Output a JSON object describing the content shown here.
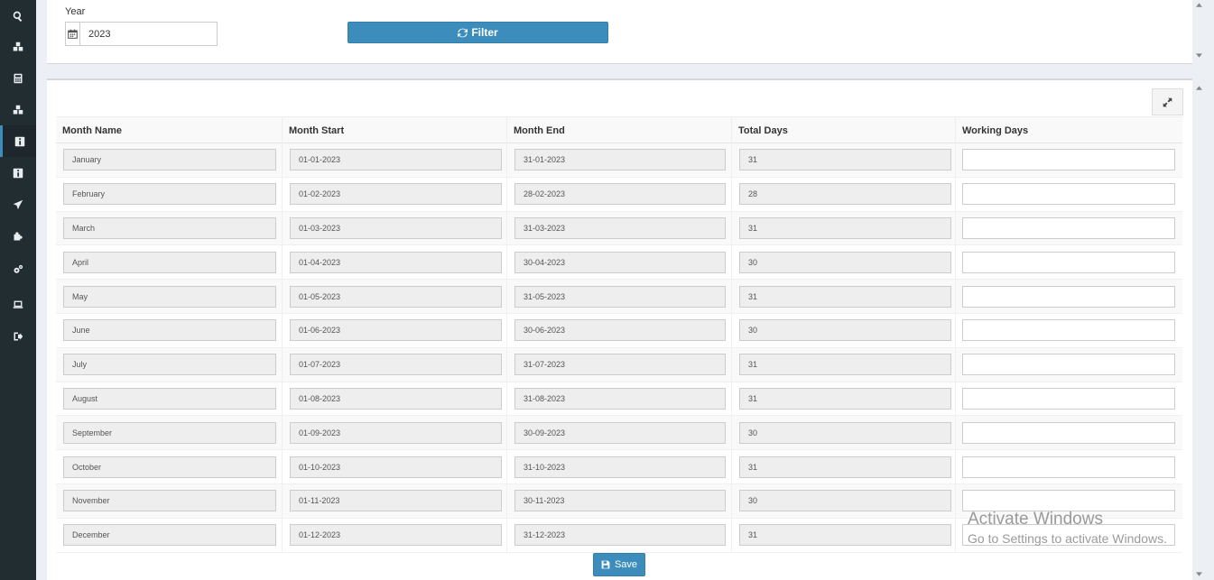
{
  "sidebar": {
    "icons": [
      "search-icon",
      "cubes-icon",
      "calculator-icon",
      "cubes-icon",
      "info-icon",
      "info-icon",
      "plane-icon",
      "puzzle-icon",
      "gears-icon",
      "laptop-icon",
      "sign-out-icon"
    ],
    "active_index": 4
  },
  "filter": {
    "year_label": "Year",
    "year_value": "2023",
    "filter_button": "Filter"
  },
  "table": {
    "headers": [
      "Month Name",
      "Month Start",
      "Month End",
      "Total Days",
      "Working Days"
    ],
    "rows": [
      {
        "month": "January",
        "start": "01-01-2023",
        "end": "31-01-2023",
        "total": "31",
        "working": ""
      },
      {
        "month": "February",
        "start": "01-02-2023",
        "end": "28-02-2023",
        "total": "28",
        "working": ""
      },
      {
        "month": "March",
        "start": "01-03-2023",
        "end": "31-03-2023",
        "total": "31",
        "working": ""
      },
      {
        "month": "April",
        "start": "01-04-2023",
        "end": "30-04-2023",
        "total": "30",
        "working": ""
      },
      {
        "month": "May",
        "start": "01-05-2023",
        "end": "31-05-2023",
        "total": "31",
        "working": ""
      },
      {
        "month": "June",
        "start": "01-06-2023",
        "end": "30-06-2023",
        "total": "30",
        "working": ""
      },
      {
        "month": "July",
        "start": "01-07-2023",
        "end": "31-07-2023",
        "total": "31",
        "working": ""
      },
      {
        "month": "August",
        "start": "01-08-2023",
        "end": "31-08-2023",
        "total": "31",
        "working": ""
      },
      {
        "month": "September",
        "start": "01-09-2023",
        "end": "30-09-2023",
        "total": "30",
        "working": ""
      },
      {
        "month": "October",
        "start": "01-10-2023",
        "end": "31-10-2023",
        "total": "31",
        "working": ""
      },
      {
        "month": "November",
        "start": "01-11-2023",
        "end": "30-11-2023",
        "total": "30",
        "working": ""
      },
      {
        "month": "December",
        "start": "01-12-2023",
        "end": "31-12-2023",
        "total": "31",
        "working": ""
      }
    ]
  },
  "actions": {
    "save_button": "Save"
  },
  "watermark": {
    "title": "Activate Windows",
    "subtitle": "Go to Settings to activate Windows."
  },
  "colors": {
    "sidebar_bg": "#222d32",
    "primary": "#3c8dbc",
    "page_bg": "#ecf0f5"
  }
}
